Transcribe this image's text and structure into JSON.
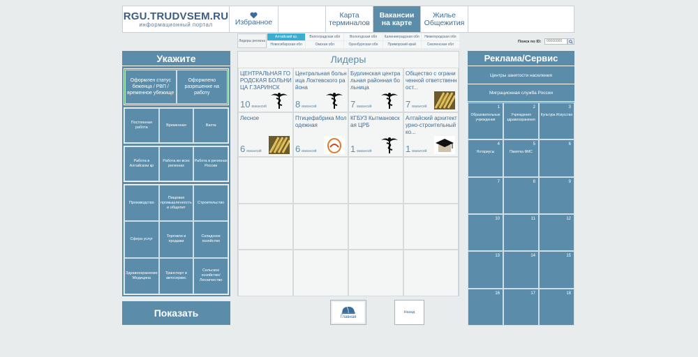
{
  "header": {
    "logo_title": "RGU.TRUDVSEM.RU",
    "logo_subtitle": "информационный портал",
    "favorites": "Избранное",
    "nav": [
      "Карта терминалов",
      "Вакансии на карте",
      "Жилье Общежития"
    ]
  },
  "regions": {
    "leaders_label": "Лидеры региона",
    "items": [
      "Алтайский кр.",
      "Волгоградская обл",
      "Вологодская обл",
      "Калининградская обл",
      "Нижегородская обл",
      "Новосибирская обл",
      "Омская обл",
      "Оренбургская обл",
      "Приморский край",
      "Смоленская обл"
    ],
    "selected": "Алтайский кр."
  },
  "search": {
    "label": "Поиск по ID:",
    "placeholder": "00000000"
  },
  "left": {
    "title": "Укажите",
    "status": [
      "Оформлен статус беженца / РВП / временное убежище",
      "Оформлено разрешение на работу"
    ],
    "employment": [
      "Постоянная работа",
      "Временная",
      "Вахта"
    ],
    "location": [
      "Работа в Алтайском кр",
      "Работа во всех регионах",
      "Работа в регионах России"
    ],
    "industries": [
      "Производство",
      "Пищевая промышленность и общепит",
      "Строительство",
      "Сфера услуг",
      "Торговля и продажи",
      "Складское хозяйство",
      "Здравоохранение Медицина",
      "Транспорт и автосервис",
      "Сельское хозяйство/ Лесничество"
    ],
    "show": "Показать"
  },
  "center": {
    "title": "Лидеры",
    "vacancy_word": "вакансий",
    "leaders": [
      {
        "name": "ЦЕНТРАЛЬНАЯ ГОРОДСКАЯ БОЛЬНИЦА Г.ЗАРИНСК",
        "count": "10",
        "icon": "caduceus-icon"
      },
      {
        "name": "Центральная больница Локтевского района",
        "count": "8",
        "icon": "caduceus-icon"
      },
      {
        "name": "Бурлинская центральная районная больница",
        "count": "7",
        "icon": "caduceus-icon"
      },
      {
        "name": "Общество с ограниченной ответственност...",
        "count": "7",
        "icon": "wheat-icon"
      },
      {
        "name": "Лесное",
        "count": "6",
        "icon": "wheat-icon"
      },
      {
        "name": "Птицефабрика Молодежная",
        "count": "6",
        "icon": "egg-logo-icon"
      },
      {
        "name": "КГБУЗ Кытмановская ЦРБ",
        "count": "1",
        "icon": "caduceus-icon"
      },
      {
        "name": "Алтайский архитектурно-строительный ко...",
        "count": "1",
        "icon": "graduation-cap-icon"
      }
    ]
  },
  "buttons": {
    "home": "Главная",
    "back": "Назад"
  },
  "right": {
    "title": "Реклама/Сервис",
    "banners": [
      "Центры занятости населения",
      "Миграционная служба России"
    ],
    "cells": [
      {
        "n": "1",
        "label": "Образовательные учреждения"
      },
      {
        "n": "2",
        "label": "Учреждения здравоохранения"
      },
      {
        "n": "3",
        "label": "Культура Искусство"
      },
      {
        "n": "4",
        "label": "Нотариусы"
      },
      {
        "n": "5",
        "label": "Памятка ФМС"
      },
      {
        "n": "6",
        "label": ""
      },
      {
        "n": "7",
        "label": ""
      },
      {
        "n": "8",
        "label": ""
      },
      {
        "n": "9",
        "label": ""
      },
      {
        "n": "10",
        "label": ""
      },
      {
        "n": "11",
        "label": ""
      },
      {
        "n": "12",
        "label": ""
      },
      {
        "n": "13",
        "label": ""
      },
      {
        "n": "14",
        "label": ""
      },
      {
        "n": "15",
        "label": ""
      },
      {
        "n": "16",
        "label": ""
      },
      {
        "n": "17",
        "label": ""
      },
      {
        "n": "18",
        "label": ""
      }
    ]
  },
  "colors": {
    "tile": "#5b8dab",
    "selected_region": "#39aed1",
    "status_border": "#56b352"
  }
}
